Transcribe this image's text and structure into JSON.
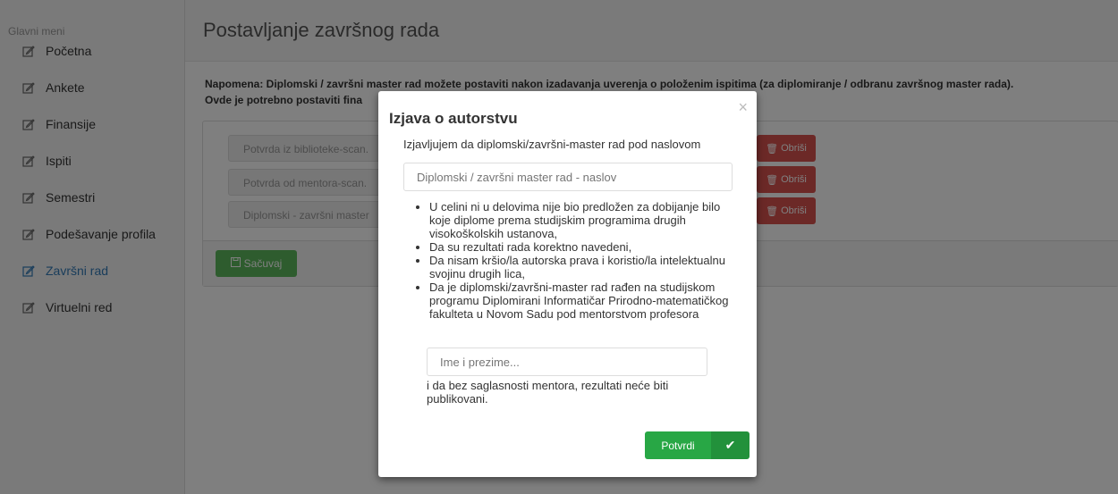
{
  "sidebar": {
    "title": "Glavni meni",
    "items": [
      {
        "label": "Početna",
        "icon": "edit-icon"
      },
      {
        "label": "Ankete",
        "icon": "edit-icon"
      },
      {
        "label": "Finansije",
        "icon": "edit-icon"
      },
      {
        "label": "Ispiti",
        "icon": "edit-icon"
      },
      {
        "label": "Semestri",
        "icon": "edit-icon"
      },
      {
        "label": "Podešavanje profila",
        "icon": "edit-icon"
      },
      {
        "label": "Završni rad",
        "icon": "edit-icon",
        "active": true
      },
      {
        "label": "Virtuelni red",
        "icon": "edit-icon"
      }
    ]
  },
  "page": {
    "title": "Postavljanje završnog rada",
    "note_line1": "Napomena: Diplomski / završni master rad možete postaviti nakon izadavanja uverenja o položenim ispitima (za diplomiranje / odbranu završnog master rada).",
    "note_line2": "Ovde je potrebno postaviti fina"
  },
  "uploads": [
    {
      "placeholder": "Potvrda iz biblioteke-scan.",
      "delete_label": "Obriši"
    },
    {
      "placeholder": "Potvrda od mentora-scan.",
      "delete_label": "Obriši"
    },
    {
      "placeholder": "Diplomski - završni master",
      "delete_label": "Obriši"
    }
  ],
  "save_label": "Sačuvaj",
  "modal": {
    "title": "Izjava o autorstvu",
    "close": "×",
    "intro": "Izjavljujem da diplomski/završni-master rad pod naslovom",
    "thesis_title_placeholder": "Diplomski / završni master rad - naslov",
    "bullets": [
      "U celini ni u delovima nije bio predložen za dobijanje bilo koje diplome prema studijskim programima drugih visokoškolskih ustanova,",
      "Da su rezultati rada korektno navedeni,",
      "Da nisam kršio/la autorska prava i koristio/la intelektualnu svojinu drugih lica,",
      "Da je diplomski/završni-master rad rađen na studijskom programu Diplomirani Informatičar Prirodno-matematičkog fakulteta u Novom Sadu pod mentorstvom profesora"
    ],
    "mentor_placeholder": "Ime i prezime...",
    "outro": "i da bez saglasnosti mentora, rezultati neće biti publikovani.",
    "confirm_label": "Potvrdi",
    "confirm_icon": "check-icon"
  },
  "colors": {
    "accent": "#337ab7",
    "danger": "#d9534f",
    "success": "#5cb85c",
    "confirm": "#28a745"
  }
}
